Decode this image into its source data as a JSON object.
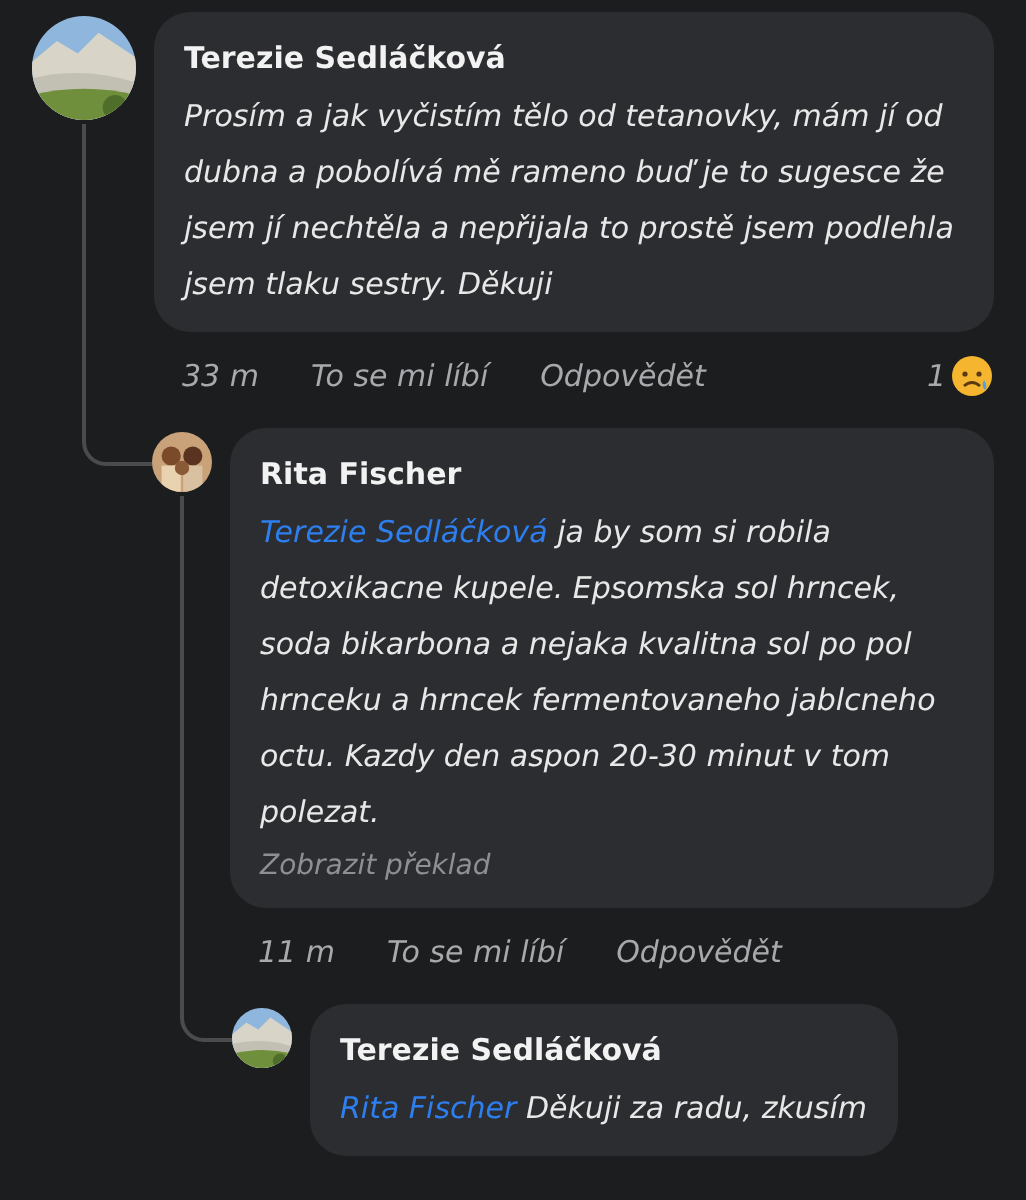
{
  "comments": [
    {
      "author": "Terezie Sedláčková",
      "text": "Prosím a jak vyčistím tělo od tetanovky, mám jí od dubna a pobolívá mě rameno buď je to sugesce že jsem jí nechtěla a nepřijala to prostě jsem podlehla jsem tlaku sestry. Děkuji",
      "time": "33 m",
      "like": "To se mi líbí",
      "reply": "Odpovědět",
      "reactions": {
        "count": "1"
      },
      "children": [
        {
          "author": "Rita Fischer",
          "mention": "Terezie Sedláčková",
          "text": "ja by som si robila detoxikacne kupele. Epsomska sol hrncek, soda bikarbona a nejaka kvalitna sol po pol hrnceku a hrncek fermentovaneho jablcneho octu. Kazdy den aspon 20-30 minut v tom polezat.",
          "translate": "Zobrazit překlad",
          "time": "11 m",
          "like": "To se mi líbí",
          "reply": "Odpovědět",
          "children": [
            {
              "author": "Terezie Sedláčková",
              "mention": "Rita Fischer",
              "text": "Děkuji za radu, zkusím"
            }
          ]
        }
      ]
    }
  ]
}
